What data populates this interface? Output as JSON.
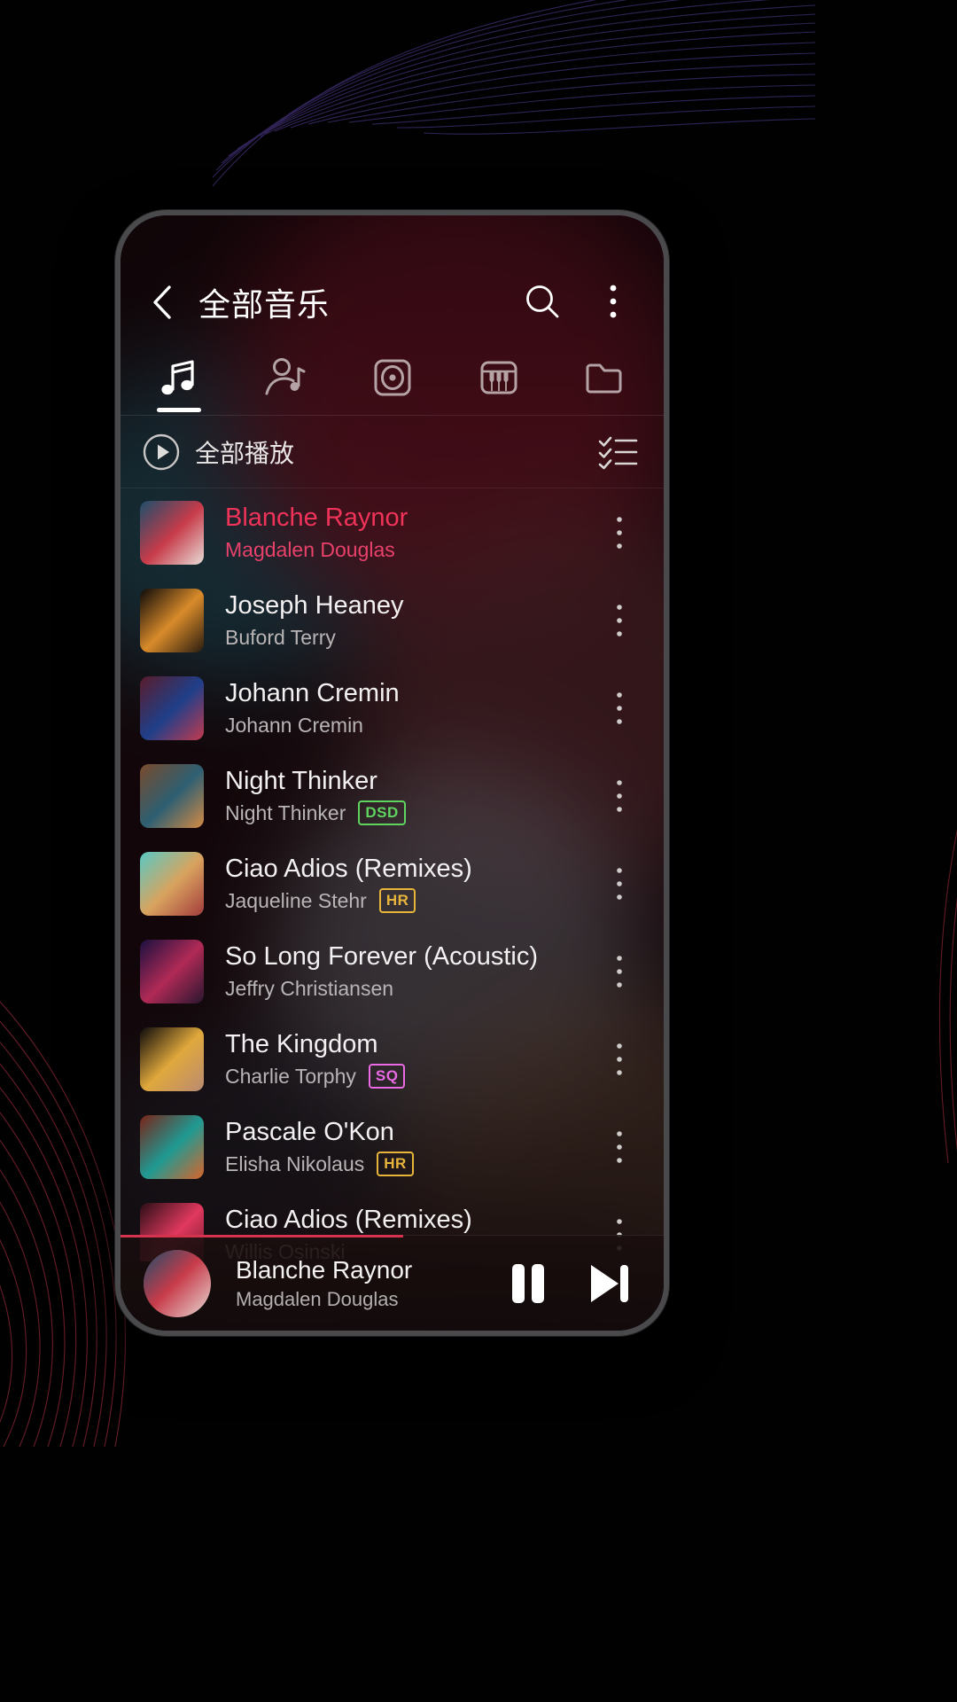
{
  "appbar": {
    "back_icon": "chevron-left-icon",
    "title": "全部音乐",
    "search_icon": "search-icon",
    "overflow_icon": "more-vertical-icon"
  },
  "tabs": [
    {
      "name": "songs",
      "icon": "music-note-icon",
      "active": true
    },
    {
      "name": "artists",
      "icon": "artist-icon",
      "active": false
    },
    {
      "name": "albums",
      "icon": "album-disc-icon",
      "active": false
    },
    {
      "name": "genres",
      "icon": "piano-keys-icon",
      "active": false
    },
    {
      "name": "folders",
      "icon": "folder-icon",
      "active": false
    }
  ],
  "playall": {
    "play_icon": "play-circle-icon",
    "label": "全部播放",
    "select_icon": "checklist-icon"
  },
  "tracks": [
    {
      "title": "Blanche Raynor",
      "artist": "Magdalen Douglas",
      "badge": "",
      "playing": true,
      "c1": "#1b4f6b",
      "c2": "#c73b4a",
      "c3": "#e8dcd6"
    },
    {
      "title": "Joseph Heaney",
      "artist": "Buford Terry",
      "badge": "",
      "playing": false,
      "c1": "#0b0a0a",
      "c2": "#d98b2a",
      "c3": "#2a1c10"
    },
    {
      "title": "Johann Cremin",
      "artist": "Johann Cremin",
      "badge": "",
      "playing": false,
      "c1": "#5b1c2a",
      "c2": "#1f3f8a",
      "c3": "#c23a4e"
    },
    {
      "title": "Night Thinker",
      "artist": "Night Thinker",
      "badge": "DSD",
      "playing": false,
      "c1": "#7a4a2c",
      "c2": "#2d5f72",
      "c3": "#d58a44"
    },
    {
      "title": "Ciao Adios (Remixes)",
      "artist": "Jaqueline Stehr",
      "badge": "HR",
      "playing": false,
      "c1": "#58c9c5",
      "c2": "#d9a35e",
      "c3": "#a23c3c"
    },
    {
      "title": "So Long Forever (Acoustic)",
      "artist": "Jeffry Christiansen",
      "badge": "",
      "playing": false,
      "c1": "#1a1040",
      "c2": "#b02a55",
      "c3": "#2a1630"
    },
    {
      "title": "The Kingdom",
      "artist": "Charlie Torphy",
      "badge": "SQ",
      "playing": false,
      "c1": "#0c0a0a",
      "c2": "#e0a83c",
      "c3": "#b98a72"
    },
    {
      "title": "Pascale O'Kon",
      "artist": "Elisha Nikolaus",
      "badge": "HR",
      "playing": false,
      "c1": "#7a2418",
      "c2": "#1f9a93",
      "c3": "#d8642a"
    },
    {
      "title": "Ciao Adios (Remixes)",
      "artist": "Willis Osinski",
      "badge": "",
      "playing": false,
      "c1": "#2a0e16",
      "c2": "#e0385e",
      "c3": "#6a1b2c"
    }
  ],
  "miniplayer": {
    "title": "Blanche Raynor",
    "artist": "Magdalen Douglas",
    "pause_icon": "pause-icon",
    "next_icon": "skip-next-icon",
    "progress_percent": 52
  },
  "colors": {
    "accent_pink": "#ef3359",
    "badge_dsd": "#5fd45f",
    "badge_hr": "#e8b53c",
    "badge_sq": "#e96ae4",
    "progress": "#d6334f"
  }
}
